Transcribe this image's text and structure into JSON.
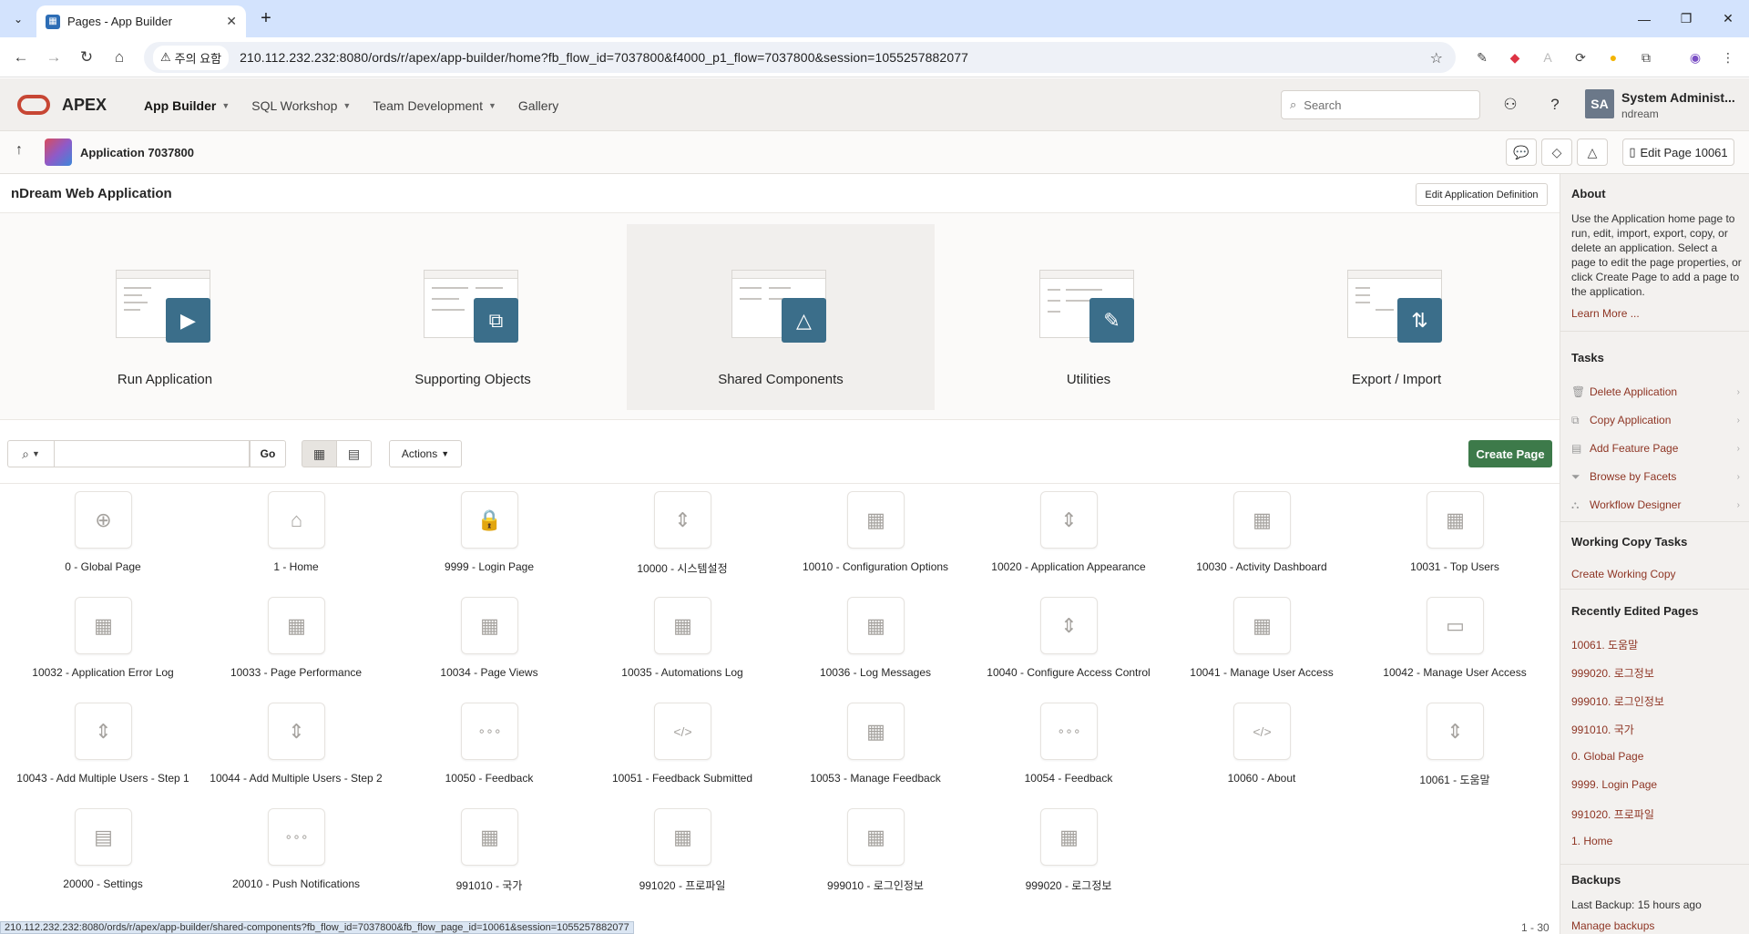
{
  "browser": {
    "tab_title": "Pages - App Builder",
    "security_label": "주의 요함",
    "url": "210.112.232.232:8080/ords/r/apex/app-builder/home?fb_flow_id=7037800&f4000_p1_flow=7037800&session=1055257882077",
    "status_url": "210.112.232.232:8080/ords/r/apex/app-builder/shared-components?fb_flow_id=7037800&fb_flow_page_id=10061&session=1055257882077"
  },
  "header": {
    "brand": "APEX",
    "nav": [
      {
        "label": "App Builder"
      },
      {
        "label": "SQL Workshop"
      },
      {
        "label": "Team Development"
      },
      {
        "label": "Gallery"
      }
    ],
    "search_placeholder": "Search",
    "avatar_initials": "SA",
    "user_name": "System Administ...",
    "workspace": "ndream"
  },
  "appbar": {
    "app_name": "Application 7037800",
    "edit_page_label": "Edit Page 10061"
  },
  "main": {
    "region_title": "nDream Web Application",
    "edit_def_label": "Edit Application Definition",
    "hero": [
      {
        "label": "Run Application",
        "icon": "play-icon",
        "glyph": "▶"
      },
      {
        "label": "Supporting Objects",
        "icon": "supporting-objects-icon",
        "glyph": "⧉"
      },
      {
        "label": "Shared Components",
        "icon": "shapes-icon",
        "glyph": "△"
      },
      {
        "label": "Utilities",
        "icon": "wrench-icon",
        "glyph": "🔧"
      },
      {
        "label": "Export / Import",
        "icon": "arrows-updown-icon",
        "glyph": "⇅"
      }
    ],
    "toolbar": {
      "go_label": "Go",
      "actions_label": "Actions",
      "create_label": "Create Page"
    },
    "pages": [
      {
        "label": "0 - Global Page",
        "icon": "globe"
      },
      {
        "label": "1 - Home",
        "icon": "home"
      },
      {
        "label": "9999 - Login Page",
        "icon": "lock"
      },
      {
        "label": "10000 - 시스템설정",
        "icon": "form"
      },
      {
        "label": "10010 - Configuration Options",
        "icon": "report-edit"
      },
      {
        "label": "10020 - Application Appearance",
        "icon": "form"
      },
      {
        "label": "10030 - Activity Dashboard",
        "icon": "grid"
      },
      {
        "label": "10031 - Top Users",
        "icon": "report-edit"
      },
      {
        "label": "10032 - Application Error Log",
        "icon": "report-edit"
      },
      {
        "label": "10033 - Page Performance",
        "icon": "report-edit"
      },
      {
        "label": "10034 - Page Views",
        "icon": "report-edit"
      },
      {
        "label": "10035 - Automations Log",
        "icon": "report-edit"
      },
      {
        "label": "10036 - Log Messages",
        "icon": "grid"
      },
      {
        "label": "10040 - Configure Access Control",
        "icon": "form"
      },
      {
        "label": "10041 - Manage User Access",
        "icon": "report-edit"
      },
      {
        "label": "10042 - Manage User Access",
        "icon": "modal"
      },
      {
        "label": "10043 - Add Multiple Users - Step 1",
        "icon": "form"
      },
      {
        "label": "10044 - Add Multiple Users - Step 2",
        "icon": "form"
      },
      {
        "label": "10050 - Feedback",
        "icon": "feedback"
      },
      {
        "label": "10051 - Feedback Submitted",
        "icon": "code"
      },
      {
        "label": "10053 - Manage Feedback",
        "icon": "report-edit"
      },
      {
        "label": "10054 - Feedback",
        "icon": "feedback"
      },
      {
        "label": "10060 - About",
        "icon": "code"
      },
      {
        "label": "10061 - 도움말",
        "icon": "form"
      },
      {
        "label": "20000 - Settings",
        "icon": "settings"
      },
      {
        "label": "20010 - Push Notifications",
        "icon": "feedback"
      },
      {
        "label": "991010 - 국가",
        "icon": "grid"
      },
      {
        "label": "991020 - 프로파일",
        "icon": "grid"
      },
      {
        "label": "999010 - 로그인정보",
        "icon": "grid"
      },
      {
        "label": "999020 - 로그정보",
        "icon": "grid"
      }
    ],
    "pagination": "1 - 30"
  },
  "sidebar": {
    "about_title": "About",
    "about_text": "Use the Application home page to run, edit, import, export, copy, or delete an application. Select a page to edit the page properties, or click Create Page to add a page to the application.",
    "learn_more": "Learn More ...",
    "tasks_title": "Tasks",
    "tasks": [
      {
        "label": "Delete Application",
        "icon": "trash-icon",
        "glyph": "🗑"
      },
      {
        "label": "Copy Application",
        "icon": "copy-icon",
        "glyph": "⧉"
      },
      {
        "label": "Add Feature Page",
        "icon": "page-add-icon",
        "glyph": "▤"
      },
      {
        "label": "Browse by Facets",
        "icon": "filter-icon",
        "glyph": "⏷"
      },
      {
        "label": "Workflow Designer",
        "icon": "workflow-icon",
        "glyph": "⛬"
      }
    ],
    "working_copy_title": "Working Copy Tasks",
    "working_copy_link": "Create Working Copy",
    "recent_title": "Recently Edited Pages",
    "recent": [
      "10061. 도움말",
      "999020. 로그정보",
      "999010. 로그인정보",
      "991010. 국가",
      "0. Global Page",
      "9999. Login Page",
      "991020. 프로파일",
      "1. Home"
    ],
    "backups_title": "Backups",
    "last_backup": "Last Backup: 15 hours ago",
    "manage_backups": "Manage backups"
  }
}
